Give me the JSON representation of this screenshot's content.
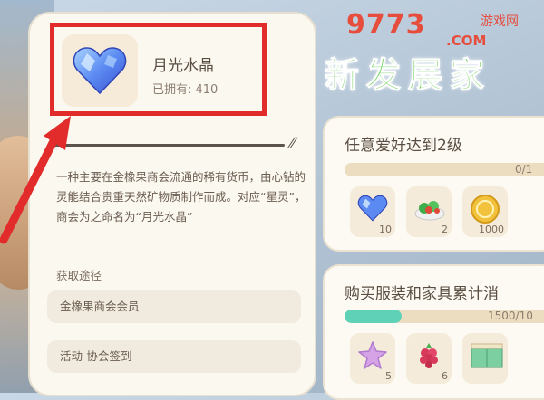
{
  "item": {
    "name": "月光水晶",
    "owned": "已拥有: 410",
    "description": "一种主要在金橡果商会流通的稀有货币，由心钻的灵能结合贵重天然矿物质制作而成。对应“星灵”，商会为之命名为“月光水晶”",
    "source_title": "获取途径",
    "sources": [
      "金橡果商会会员",
      "活动-协会签到"
    ]
  },
  "watermark": {
    "main": "9773",
    "sub": "游戏网",
    "com": ".COM"
  },
  "banner": {
    "title": "新发展家"
  },
  "tasks": [
    {
      "title": "任意爱好达到2级",
      "progress_text": "0/1",
      "progress": 0,
      "rewards": [
        {
          "icon": "blue-heart-crystal-icon",
          "count": "10"
        },
        {
          "icon": "salad-dish-icon",
          "count": "2"
        },
        {
          "icon": "gold-coin-icon",
          "count": "1000"
        }
      ]
    },
    {
      "title": "购买服装和家具累计消",
      "progress_text": "1500/10",
      "progress": 0.25,
      "rewards": [
        {
          "icon": "pink-star-icon",
          "count": "5"
        },
        {
          "icon": "raspberry-icon",
          "count": "6"
        },
        {
          "icon": "cabinet-furniture-icon",
          "count": ""
        }
      ]
    }
  ],
  "colors": {
    "highlight": "#e22b2b",
    "progress": "#5fd1b6",
    "banner": "#7cd36a"
  }
}
